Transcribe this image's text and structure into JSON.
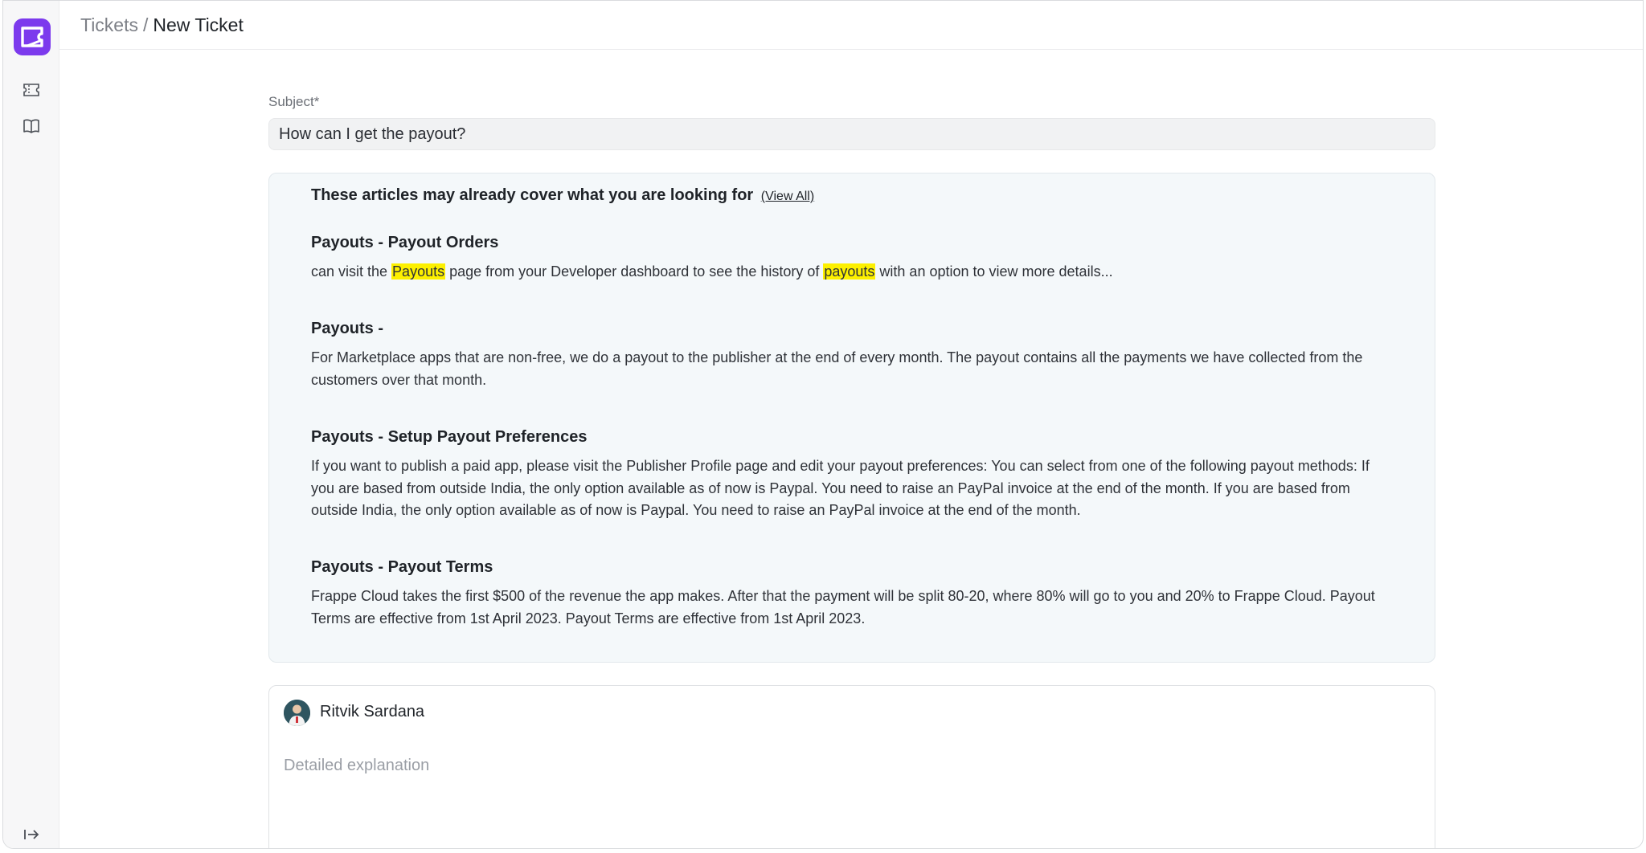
{
  "breadcrumb": {
    "parent": "Tickets",
    "separator": "/",
    "current": "New Ticket"
  },
  "subject": {
    "label": "Subject*",
    "value": "How can I get the payout?"
  },
  "articles": {
    "heading": "These articles may already cover what you are looking for",
    "view_all": "(View All)",
    "items": [
      {
        "title": "Payouts - Payout Orders",
        "excerpt_parts": [
          "can visit the ",
          "Payouts",
          " page from your Developer dashboard to see the history of ",
          "payouts",
          " with an option to view more details..."
        ]
      },
      {
        "title": "Payouts -",
        "excerpt": "For Marketplace apps that are non-free, we do a payout to the publisher at the end of every month. The payout contains all the payments we have collected from the customers over that month."
      },
      {
        "title": "Payouts - Setup Payout Preferences",
        "excerpt": "If you want to publish a paid app, please visit the Publisher Profile page and edit your payout preferences: You can select from one of the following payout methods: If you are based from outside India, the only option available as of now is Paypal. You need to raise an PayPal invoice at the end of the month. If you are based from outside India, the only option available as of now is Paypal. You need to raise an PayPal invoice at the end of the month."
      },
      {
        "title": "Payouts - Payout Terms",
        "excerpt": "Frappe Cloud takes the first $500 of the revenue the app makes. After that the payment will be split 80-20, where 80% will go to you and 20% to Frappe Cloud. Payout Terms are effective from 1st April 2023. Payout Terms are effective from 1st April 2023."
      }
    ]
  },
  "editor": {
    "author": "Ritvik Sardana",
    "placeholder": "Detailed explanation"
  },
  "sidebar": {
    "icons": [
      "ticket-icon",
      "book-open-icon",
      "collapse-sidebar-icon"
    ]
  },
  "colors": {
    "brand": "#7c3aed",
    "highlight": "#fdf000",
    "panel_bg": "#f4f8fa"
  }
}
